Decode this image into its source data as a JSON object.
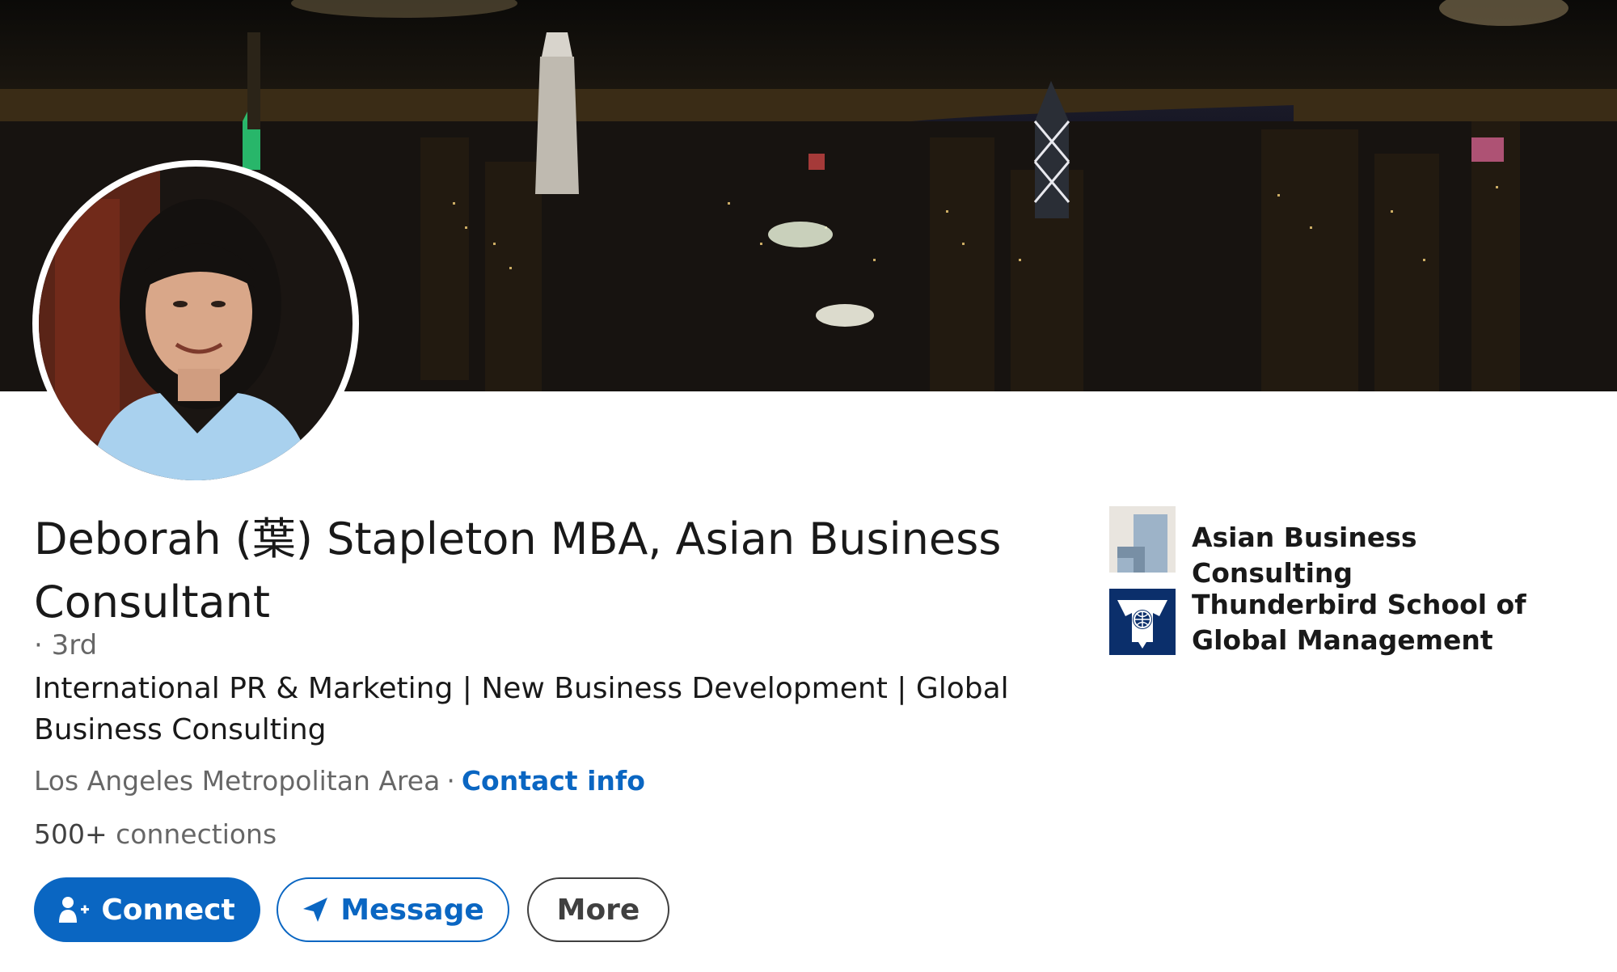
{
  "profile": {
    "name": "Deborah (葉) Stapleton MBA, Asian Business Consultant",
    "degree": "· 3rd",
    "headline": "International PR & Marketing | New Business Development | Global Business Consulting",
    "location": "Los Angeles Metropolitan Area",
    "location_separator": "·",
    "contact_link": "Contact info",
    "connections_count": "500+",
    "connections_label": "connections"
  },
  "actions": {
    "connect_label": "Connect",
    "message_label": "Message",
    "more_label": "More"
  },
  "orgs": [
    {
      "name": "Asian Business Consulting",
      "logo": "company-placeholder-icon"
    },
    {
      "name": "Thunderbird School of Global Management",
      "logo": "thunderbird-logo"
    }
  ],
  "colors": {
    "primary": "#0a66c2",
    "thunderbird_navy": "#0b2f6b"
  },
  "banner_image": "night-city-skyline",
  "avatar_image": "profile-photo"
}
